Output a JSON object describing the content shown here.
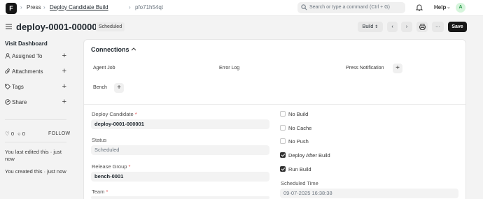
{
  "navbar": {
    "logo": "F",
    "breadcrumbs": [
      "Press",
      "Deploy Candidate Build",
      "pfo71h54qt"
    ],
    "search_placeholder": "Search or type a command (Ctrl + G)",
    "help_label": "Help",
    "avatar_initial": "A"
  },
  "page": {
    "title": "deploy-0001-000001",
    "status": "Scheduled",
    "build_button": "Build",
    "save_button": "Save"
  },
  "sidebar": {
    "heading": "Visit Dashboard",
    "items": [
      {
        "label": "Assigned To",
        "icon": "user-icon"
      },
      {
        "label": "Attachments",
        "icon": "paperclip-icon"
      },
      {
        "label": "Tags",
        "icon": "tag-icon"
      },
      {
        "label": "Share",
        "icon": "share-icon"
      }
    ],
    "likes": "0",
    "comments": "0",
    "follow": "FOLLOW",
    "last_edited": "You last edited this · just now",
    "created": "You created this · just now"
  },
  "connections": {
    "title": "Connections",
    "items": [
      "Agent Job",
      "Error Log",
      "Press Notification",
      "Bench"
    ]
  },
  "form": {
    "deploy_candidate_label": "Deploy Candidate",
    "deploy_candidate_value": "deploy-0001-000001",
    "status_label": "Status",
    "status_value": "Scheduled",
    "release_group_label": "Release Group",
    "release_group_value": "bench-0001",
    "team_label": "Team",
    "checkboxes": [
      {
        "label": "No Build",
        "checked": false
      },
      {
        "label": "No Cache",
        "checked": false
      },
      {
        "label": "No Push",
        "checked": false
      },
      {
        "label": "Deploy After Build",
        "checked": true
      },
      {
        "label": "Run Build",
        "checked": true
      }
    ],
    "scheduled_time_label": "Scheduled Time",
    "scheduled_time_value": "09-07-2025 16:38:38"
  }
}
